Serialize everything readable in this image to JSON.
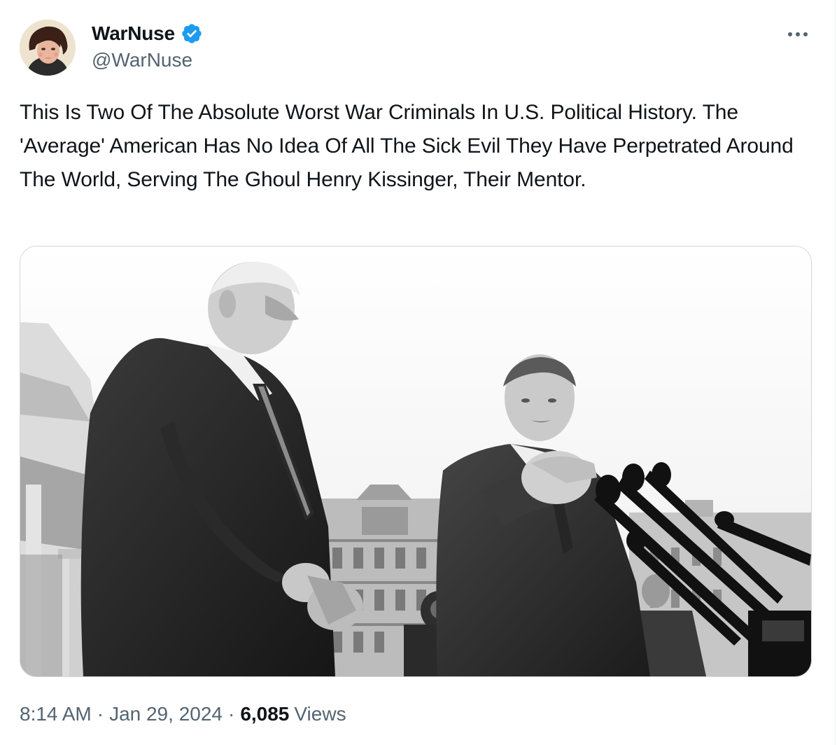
{
  "author": {
    "name": "WarNuse",
    "handle": "@WarNuse",
    "verified_icon": "verified-badge-icon",
    "avatar": "avatar"
  },
  "more_icon": "more-horizontal-icon",
  "tweet": {
    "text": "This Is Two Of The Absolute Worst War Criminals In U.S. Political History. The 'Average' American Has No Idea Of All The Sick Evil They Have Perpetrated Around The World, Serving The Ghoul Henry Kissinger, Their Mentor."
  },
  "meta": {
    "time": "8:14 AM",
    "separator": "·",
    "date": "Jan 29, 2024",
    "views_count": "6,085",
    "views_label": "Views"
  },
  "colors": {
    "text_primary": "#0f1419",
    "text_secondary": "#536471",
    "verified_blue": "#1d9bf0",
    "media_border": "#cfd9de"
  }
}
